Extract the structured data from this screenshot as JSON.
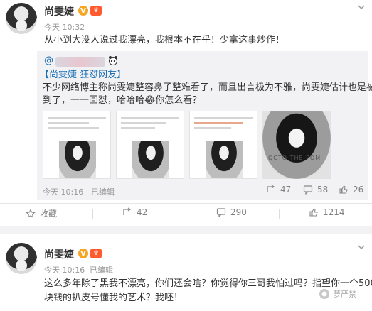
{
  "post1": {
    "username": "尚雯婕",
    "verified_badge": "V",
    "level_badge": "♛",
    "time": "今天 10:32",
    "text": "从小到大没人说过我漂亮，我根本不在乎！少拿这事炒作！",
    "repost": {
      "author_prefix": "@",
      "tag": "【尚雯婕 狂怼网友】",
      "body_line1": "不少网络博主称尚雯婕整容鼻子整难看了，而且出言极为不雅，尚雯婕估计也是被气",
      "body_line2": "到了，一一回怼，哈哈哈😂你怎么看？",
      "time": "今天 10:16",
      "edited": "已编辑",
      "repost_count": "47",
      "comment_count": "58",
      "like_count": "26",
      "watermark": "OCTO THE POM"
    },
    "actions": {
      "favorite": "收藏",
      "repost": "42",
      "comment": "290",
      "like": "1214"
    }
  },
  "post2": {
    "username": "尚雯婕",
    "verified_badge": "V",
    "level_badge": "♛",
    "time": "今天 10:16",
    "edited": "已编辑",
    "text_line1": "这么多年除了黑我不漂亮，你们还会啥？你觉得你三哥我怕过吗？指望你一个500",
    "text_line2": "块钱的扒皮号懂我的艺术？我呸！"
  },
  "watermark_brand": "萝严禁",
  "colors": {
    "verified": "#f5a623",
    "level": "#ff5b2e",
    "tag_blue": "#1a6fb3",
    "repost_bg": "#f2f2f5"
  }
}
